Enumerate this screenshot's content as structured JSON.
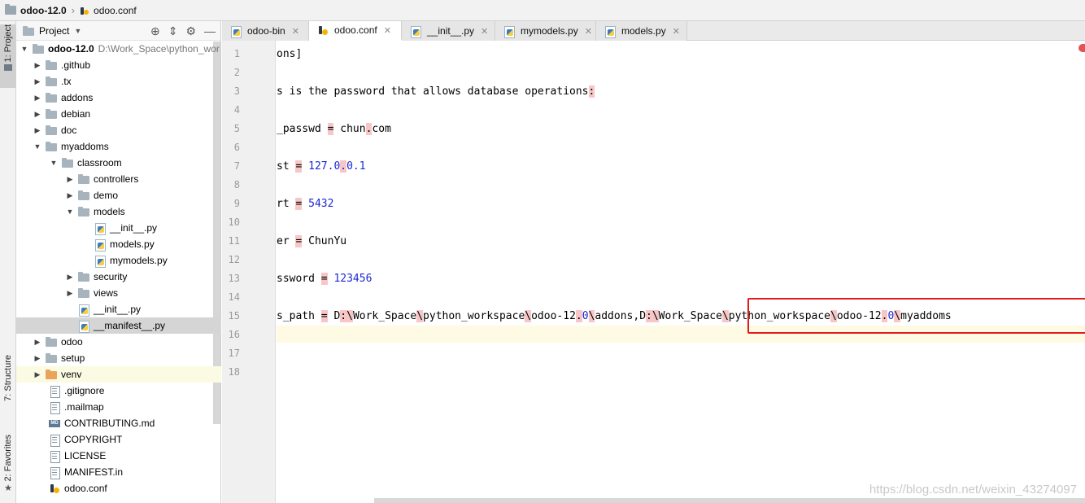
{
  "breadcrumb": {
    "project": "odoo-12.0",
    "file": "odoo.conf"
  },
  "toolstrip": {
    "project_tab": "1: Project",
    "structure_tab": "7: Structure",
    "favorites_tab": "2: Favorites"
  },
  "project_panel": {
    "title": "Project",
    "root_name": "odoo-12.0",
    "root_path": "D:\\Work_Space\\python_wor",
    "items": [
      {
        "label": ".github"
      },
      {
        "label": ".tx"
      },
      {
        "label": "addons"
      },
      {
        "label": "debian"
      },
      {
        "label": "doc"
      },
      {
        "label": "myaddoms"
      },
      {
        "label": "classroom"
      },
      {
        "label": "controllers"
      },
      {
        "label": "demo"
      },
      {
        "label": "models"
      },
      {
        "label": "__init__.py"
      },
      {
        "label": "models.py"
      },
      {
        "label": "mymodels.py"
      },
      {
        "label": "security"
      },
      {
        "label": "views"
      },
      {
        "label": "__init__.py"
      },
      {
        "label": "__manifest__.py"
      },
      {
        "label": "odoo"
      },
      {
        "label": "setup"
      },
      {
        "label": "venv"
      },
      {
        "label": ".gitignore"
      },
      {
        "label": ".mailmap"
      },
      {
        "label": "CONTRIBUTING.md"
      },
      {
        "label": "COPYRIGHT"
      },
      {
        "label": "LICENSE"
      },
      {
        "label": "MANIFEST.in"
      },
      {
        "label": "odoo.conf"
      }
    ]
  },
  "tabs": [
    {
      "label": "odoo-bin"
    },
    {
      "label": "odoo.conf"
    },
    {
      "label": "__init__.py"
    },
    {
      "label": "mymodels.py"
    },
    {
      "label": "models.py"
    }
  ],
  "editor": {
    "line_numbers": [
      "1",
      "2",
      "3",
      "4",
      "5",
      "6",
      "7",
      "8",
      "9",
      "10",
      "11",
      "12",
      "13",
      "14",
      "15",
      "16",
      "17",
      "18"
    ],
    "lines": {
      "l1": "ons]",
      "l3_a": "s is the password that allows database operations",
      "l3_b": ":",
      "l5_a": "_passwd ",
      "l5_b": "=",
      "l5_c": " chun",
      "l5_d": ".",
      "l5_e": "com",
      "l7_a": "st ",
      "l7_b": "=",
      "l7_c": " ",
      "l7_d": "127.0",
      "l7_e": ".",
      "l7_f": "0.1",
      "l9_a": "rt ",
      "l9_b": "=",
      "l9_c": " ",
      "l9_d": "5432",
      "l11_a": "er ",
      "l11_b": "=",
      "l11_c": " ChunYu",
      "l13_a": "ssword ",
      "l13_b": "=",
      "l13_c": " ",
      "l13_d": "123456",
      "l15_a": "s_path ",
      "l15_b": "=",
      "l15_c": " D",
      "l15_d": ":",
      "l15_e": "\\",
      "l15_f": "Work_Space",
      "l15_g": "\\",
      "l15_h": "python_workspace",
      "l15_i": "\\",
      "l15_j": "odoo-12",
      "l15_k": ".",
      "l15_l": "0",
      "l15_m": "\\",
      "l15_n": "addons,",
      "l15_o": "D",
      "l15_p": ":",
      "l15_q": "\\",
      "l15_r": "Work_Space",
      "l15_s": "\\",
      "l15_t": "python_workspace",
      "l15_u": "\\",
      "l15_v": "odoo-12",
      "l15_w": ".",
      "l15_x": "0",
      "l15_y": "\\",
      "l15_z": "myaddoms"
    }
  },
  "watermark": "https://blog.csdn.net/weixin_43274097",
  "colors": {
    "highlight_box": "#e3191c",
    "number": "#1d28d4",
    "error_bg": "#f8c6c6",
    "current_line": "#fffae3"
  }
}
